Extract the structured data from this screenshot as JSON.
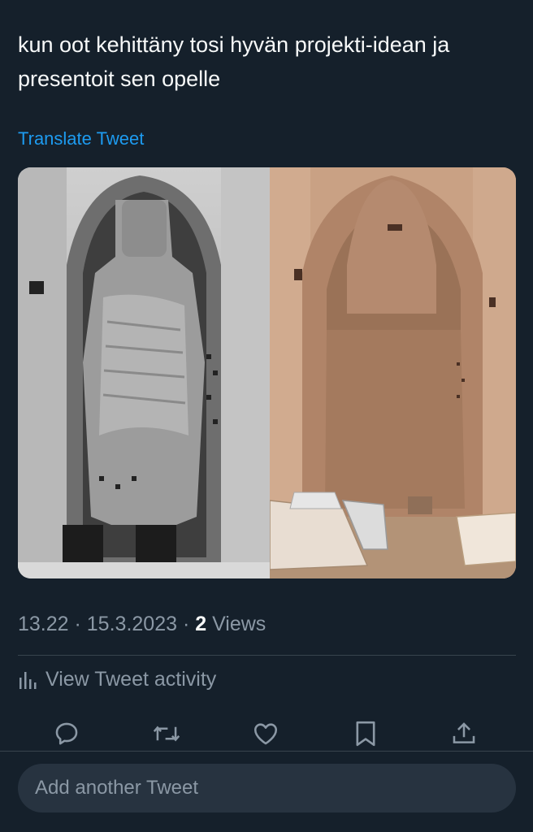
{
  "tweet": {
    "text": "kun oot kehittäny tosi hyvän projekti-idean ja presentoit sen opelle",
    "translate_label": "Translate Tweet",
    "time": "13.22",
    "separator": " · ",
    "date": "15.3.2023",
    "views_count": "2",
    "views_label": " Views"
  },
  "activity": {
    "label": "View Tweet activity",
    "icon": "bar-chart-icon"
  },
  "actions": [
    {
      "name": "reply",
      "icon": "reply-icon"
    },
    {
      "name": "retweet",
      "icon": "retweet-icon"
    },
    {
      "name": "like",
      "icon": "heart-icon"
    },
    {
      "name": "bookmark",
      "icon": "bookmark-icon"
    },
    {
      "name": "share",
      "icon": "share-icon"
    }
  ],
  "composer": {
    "placeholder": "Add another Tweet"
  },
  "colors": {
    "background": "#15202b",
    "link": "#1d9bf0",
    "secondary_text": "#8b98a5",
    "divider": "#38444d",
    "input_background": "#273340"
  }
}
